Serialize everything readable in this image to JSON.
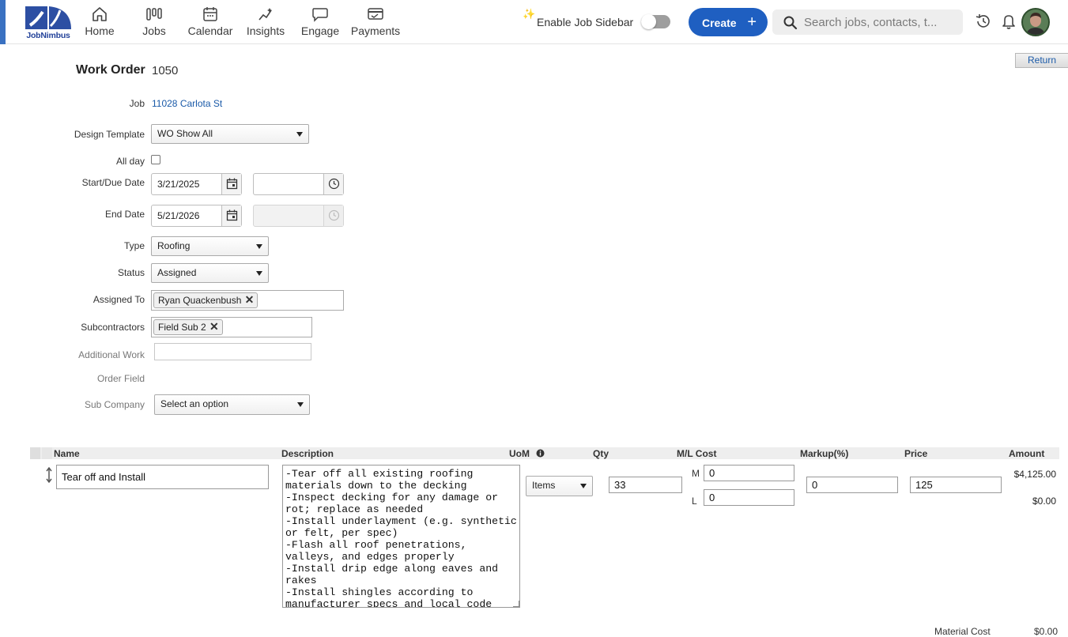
{
  "nav": {
    "brand": "JobNimbus",
    "items": [
      {
        "label": "Home",
        "icon": "home-icon"
      },
      {
        "label": "Jobs",
        "icon": "jobs-icon"
      },
      {
        "label": "Calendar",
        "icon": "calendar-icon"
      },
      {
        "label": "Insights",
        "icon": "insights-icon"
      },
      {
        "label": "Engage",
        "icon": "engage-icon"
      },
      {
        "label": "Payments",
        "icon": "payments-icon"
      }
    ],
    "sidebar_toggle_label": "Enable Job Sidebar",
    "sidebar_toggle_on": false,
    "create_label": "Create",
    "search_placeholder": "Search jobs, contacts, t..."
  },
  "form": {
    "return_label": "Return",
    "title": "Work Order",
    "number": "1050",
    "job_label": "Job",
    "job_value": "11028 Carlota St",
    "design_template_label": "Design Template",
    "design_template_value": "WO Show All",
    "all_day_label": "All day",
    "all_day_checked": false,
    "start_due_label": "Start/Due Date",
    "start_date": "3/21/2025",
    "start_time": "",
    "end_date_label": "End Date",
    "end_date": "5/21/2026",
    "end_time": "",
    "type_label": "Type",
    "type_value": "Roofing",
    "status_label": "Status",
    "status_value": "Assigned",
    "assigned_to_label": "Assigned To",
    "assigned_to_tag": "Ryan Quackenbush",
    "subcontractors_label": "Subcontractors",
    "subcontractors_tag": "Field Sub 2",
    "additional_work_label": "Additional Work",
    "additional_work_value": "",
    "order_field_label": "Order Field",
    "sub_company_label": "Sub Company",
    "sub_company_value": "Select an option"
  },
  "line_items": {
    "headers": {
      "name": "Name",
      "description": "Description",
      "uom": "UoM",
      "qty": "Qty",
      "ml_cost": "M/L Cost",
      "markup": "Markup(%)",
      "price": "Price",
      "amount": "Amount"
    },
    "rows": [
      {
        "name": "Tear off and Install",
        "description": "-Tear off all existing roofing materials down to the decking\n-Inspect decking for any damage or rot; replace as needed\n-Install underlayment (e.g. synthetic or felt, per spec)\n-Flash all roof penetrations, valleys, and edges properly\n-Install drip edge along eaves and rakes\n-Install shingles according to manufacturer specs and local code",
        "uom": "Items",
        "qty": "33",
        "m_label": "M",
        "m_cost": "0",
        "l_label": "L",
        "l_cost": "0",
        "markup": "0",
        "price": "125",
        "amount_m": "$4,125.00",
        "amount_l": "$0.00"
      }
    ]
  },
  "totals": {
    "material_cost_label": "Material Cost",
    "material_cost_value": "$0.00"
  }
}
